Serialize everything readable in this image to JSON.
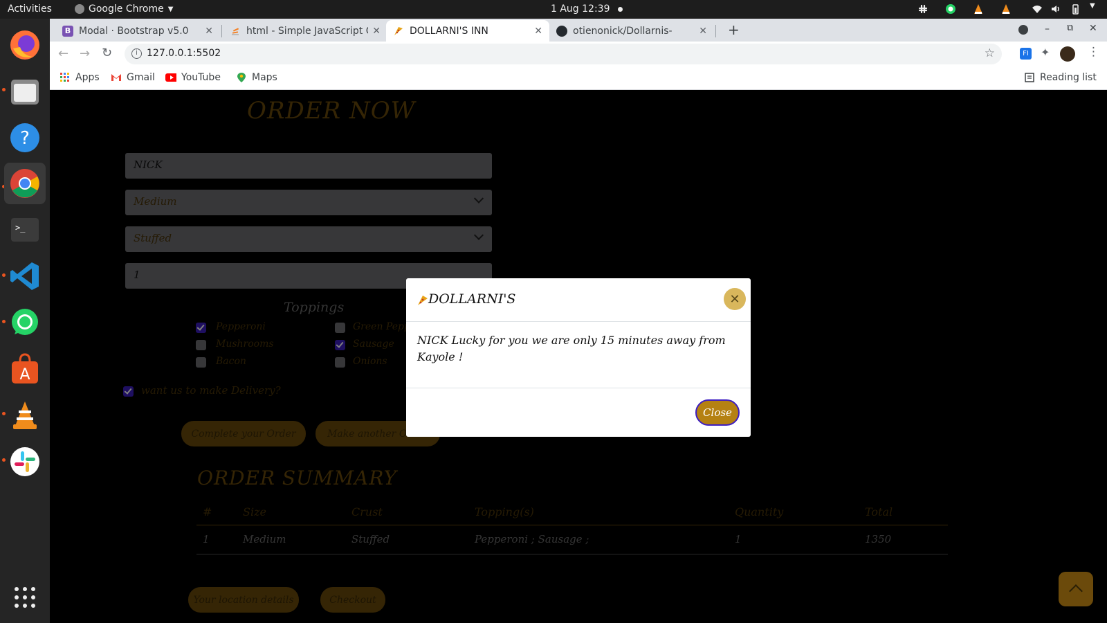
{
  "topbar": {
    "activities": "Activities",
    "app_name": "Google Chrome",
    "datetime": "1 Aug  12:39"
  },
  "tabs": [
    {
      "title": "Modal · Bootstrap v5.0",
      "favicon_text": "B",
      "favicon_color": "#7952b3"
    },
    {
      "title": "html - Simple JavaScript C",
      "favicon_text": "",
      "favicon_color": "#f48024"
    },
    {
      "title": "DOLLARNI'S INN",
      "favicon_text": "",
      "favicon_color": "#e8a317"
    },
    {
      "title": "otienonick/Dollarnis-",
      "favicon_text": "",
      "favicon_color": "#24292e"
    }
  ],
  "toolbar": {
    "url": "127.0.0.1:5502"
  },
  "bookmarks": {
    "apps": "Apps",
    "gmail": "Gmail",
    "youtube": "YouTube",
    "maps": "Maps",
    "reading_list": "Reading list"
  },
  "page": {
    "order_heading": "ORDER NOW",
    "name_value": "NICK",
    "size_value": "Medium",
    "crust_value": "Stuffed",
    "quantity_value": "1",
    "toppings_heading": "Toppings",
    "toppings": [
      {
        "label": "Pepperoni",
        "checked": true
      },
      {
        "label": "Green Peppers",
        "checked": false
      },
      {
        "label": "Mushrooms",
        "checked": false
      },
      {
        "label": "Sausage",
        "checked": true
      },
      {
        "label": "Bacon",
        "checked": false
      },
      {
        "label": "Onions",
        "checked": false
      }
    ],
    "delivery_label": "want us to make Delivery?",
    "delivery_checked": true,
    "complete_button": "Complete your Order",
    "another_button": "Make another Order",
    "summary_heading": "ORDER SUMMARY",
    "table_headers": [
      "#",
      "Size",
      "Crust",
      "Topping(s)",
      "Quantity",
      "Total"
    ],
    "table_rows": [
      [
        "1",
        "Medium",
        "Stuffed",
        "Pepperoni ; Sausage ;",
        "1",
        "1350"
      ]
    ],
    "location_button": "Your location details",
    "checkout_button": "Checkout"
  },
  "modal": {
    "title": "DOLLARNI'S",
    "body": "NICK Lucky for you we are only 15 minutes away from Kayole !",
    "close_button": "Close"
  },
  "colors": {
    "accent_gold": "#b58112",
    "modal_close_bg": "#d9b75c",
    "checkbox_checked": "#3d1ec2"
  }
}
